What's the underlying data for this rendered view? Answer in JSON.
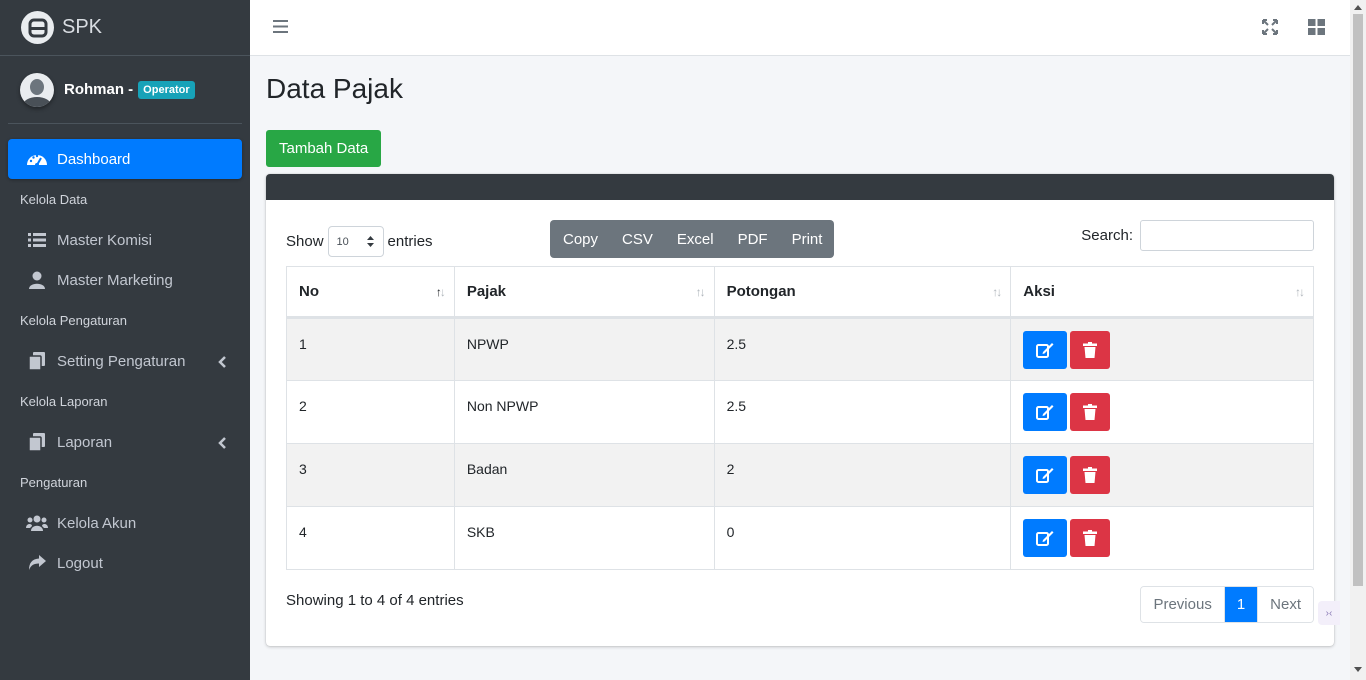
{
  "brand": {
    "name": "SPK"
  },
  "user": {
    "name": "Rohman -",
    "role": "Operator"
  },
  "sidebar": {
    "dashboard": "Dashboard",
    "header_data": "Kelola Data",
    "master_komisi": "Master Komisi",
    "master_marketing": "Master Marketing",
    "header_pengaturan": "Kelola Pengaturan",
    "setting_pengaturan": "Setting Pengaturan",
    "header_laporan": "Kelola Laporan",
    "laporan": "Laporan",
    "header_akun": "Pengaturan",
    "kelola_akun": "Kelola Akun",
    "logout": "Logout"
  },
  "page": {
    "title": "Data Pajak",
    "add_button": "Tambah Data"
  },
  "table_controls": {
    "show_label": "Show",
    "entries_label": "entries",
    "page_length": "10",
    "search_label": "Search:",
    "export_buttons": [
      "Copy",
      "CSV",
      "Excel",
      "PDF",
      "Print"
    ]
  },
  "table": {
    "columns": [
      "No",
      "Pajak",
      "Potongan",
      "Aksi"
    ],
    "rows": [
      {
        "no": "1",
        "pajak": "NPWP",
        "potongan": "2.5"
      },
      {
        "no": "2",
        "pajak": "Non NPWP",
        "potongan": "2.5"
      },
      {
        "no": "3",
        "pajak": "Badan",
        "potongan": "2"
      },
      {
        "no": "4",
        "pajak": "SKB",
        "potongan": "0"
      }
    ]
  },
  "footer": {
    "info": "Showing 1 to 4 of 4 entries",
    "previous": "Previous",
    "current_page": "1",
    "next": "Next"
  },
  "colors": {
    "sidebar_bg": "#343a40",
    "active": "#007bff",
    "success": "#28a745",
    "danger": "#dc3545",
    "secondary": "#6c757d",
    "badge": "#17a2b8"
  },
  "icons": {
    "dashboard": "tachometer-icon",
    "master_komisi": "list-icon",
    "master_marketing": "user-icon",
    "setting_pengaturan": "copy-icon",
    "laporan": "copy-icon",
    "kelola_akun": "users-icon",
    "logout": "share-icon"
  }
}
